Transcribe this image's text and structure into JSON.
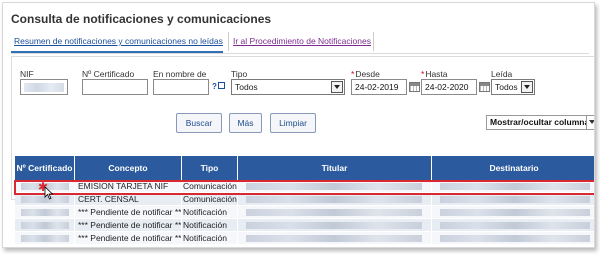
{
  "page": {
    "title": "Consulta de notificaciones y comunicaciones"
  },
  "tabs": [
    {
      "label": "Resumen de notificaciones y comunicaciones no leídas"
    },
    {
      "label": "Ir al Procedimiento de Notificaciones"
    }
  ],
  "filters": {
    "nif": {
      "label": "NIF",
      "value": ""
    },
    "certificado": {
      "label": "Nº Certificado",
      "value": ""
    },
    "nombre": {
      "label": "En nombre de",
      "value": ""
    },
    "tipo": {
      "label": "Tipo",
      "value": "Todos"
    },
    "desde": {
      "label": "Desde",
      "value": "24-02-2019",
      "required_mark": "*"
    },
    "hasta": {
      "label": "Hasta",
      "value": "24-02-2020",
      "required_mark": "*"
    },
    "leida": {
      "label": "Leída",
      "value": "Todos"
    },
    "help_glyph": "?"
  },
  "buttons": {
    "buscar": "Buscar",
    "mas": "Más",
    "limpiar": "Limpiar"
  },
  "columns_toggle": "Mostrar/ocultar columnas",
  "table": {
    "headers": [
      "Nº Certificado",
      "Concepto",
      "Tipo",
      "Titular",
      "Destinatario"
    ],
    "rows": [
      {
        "concepto": "EMISION TARJETA NIF",
        "tipo": "Comunicación"
      },
      {
        "concepto": "CERT. CENSAL",
        "tipo": "Comunicación"
      },
      {
        "concepto": "*** Pendiente de notificar ***",
        "tipo": "Notificación"
      },
      {
        "concepto": "*** Pendiente de notificar ***",
        "tipo": "Notificación"
      },
      {
        "concepto": "*** Pendiente de notificar ***",
        "tipo": "Notificación"
      }
    ]
  },
  "colors": {
    "header_bg": "#2c5a9e",
    "highlight": "#d9282f",
    "link": "#1a4f9c",
    "visited_link": "#7b2d8e"
  },
  "icons": {
    "help": "help-external-icon",
    "calendar": "calendar-icon",
    "dropdown": "chevron-down-icon",
    "cursor": "mouse-pointer-icon"
  }
}
